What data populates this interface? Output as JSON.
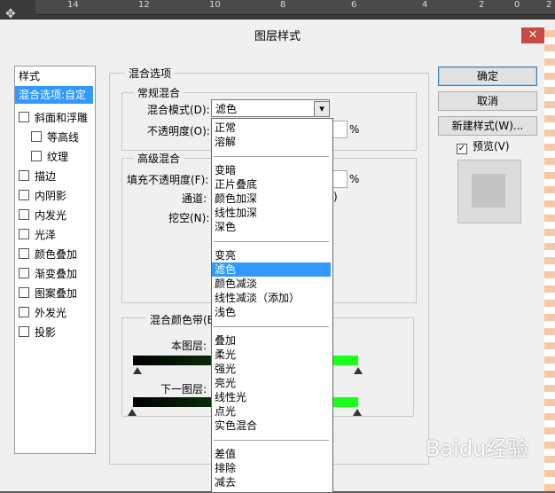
{
  "ruler": {
    "mark1": "14",
    "mark2": "12",
    "mark3": "10",
    "mark4": "8",
    "mark5": "6",
    "mark6": "4",
    "mark7": "2",
    "mark8": "0",
    "mark9": "2"
  },
  "dialog": {
    "title": "图层样式",
    "close_glyph": "✕"
  },
  "styles": {
    "header": "样式",
    "selected": "混合选项:自定",
    "items": [
      "斜面和浮雕",
      "等高线",
      "纹理",
      "描边",
      "内阴影",
      "内发光",
      "光泽",
      "颜色叠加",
      "渐变叠加",
      "图案叠加",
      "外发光",
      "投影"
    ]
  },
  "blend_options": {
    "group_label": "混合选项",
    "general_label": "常规混合",
    "blend_mode_label": "混合模式(D):",
    "blend_mode_value": "滤色",
    "opacity_label": "不透明度(O):",
    "percent": "%",
    "advanced_label": "高级混合",
    "fill_opacity_label": "填充不透明度(F):",
    "channels_label": "通道:",
    "knockout_label": "挖空(N):",
    "blend_if_label": "混合颜色带(E",
    "this_layer_label": "本图层:",
    "under_layer_label": "下一图层:"
  },
  "buttons": {
    "ok": "确定",
    "cancel": "取消",
    "new_style": "新建样式(W)...",
    "preview": "预览(V)"
  },
  "dropdown": {
    "group1": [
      "正常",
      "溶解"
    ],
    "group2": [
      "变暗",
      "正片叠底",
      "颜色加深",
      "线性加深",
      "深色"
    ],
    "group3": [
      "变亮",
      "滤色",
      "颜色减淡",
      "线性减淡（添加）",
      "浅色"
    ],
    "group4": [
      "叠加",
      "柔光",
      "强光",
      "亮光",
      "线性光",
      "点光",
      "实色混合"
    ],
    "group5": [
      "差值",
      "排除",
      "减去"
    ]
  },
  "watermark": "Baidu经验",
  "colors": {
    "selection": "#3399ff",
    "green_band": "#19ff19",
    "close": "#c94a44"
  }
}
